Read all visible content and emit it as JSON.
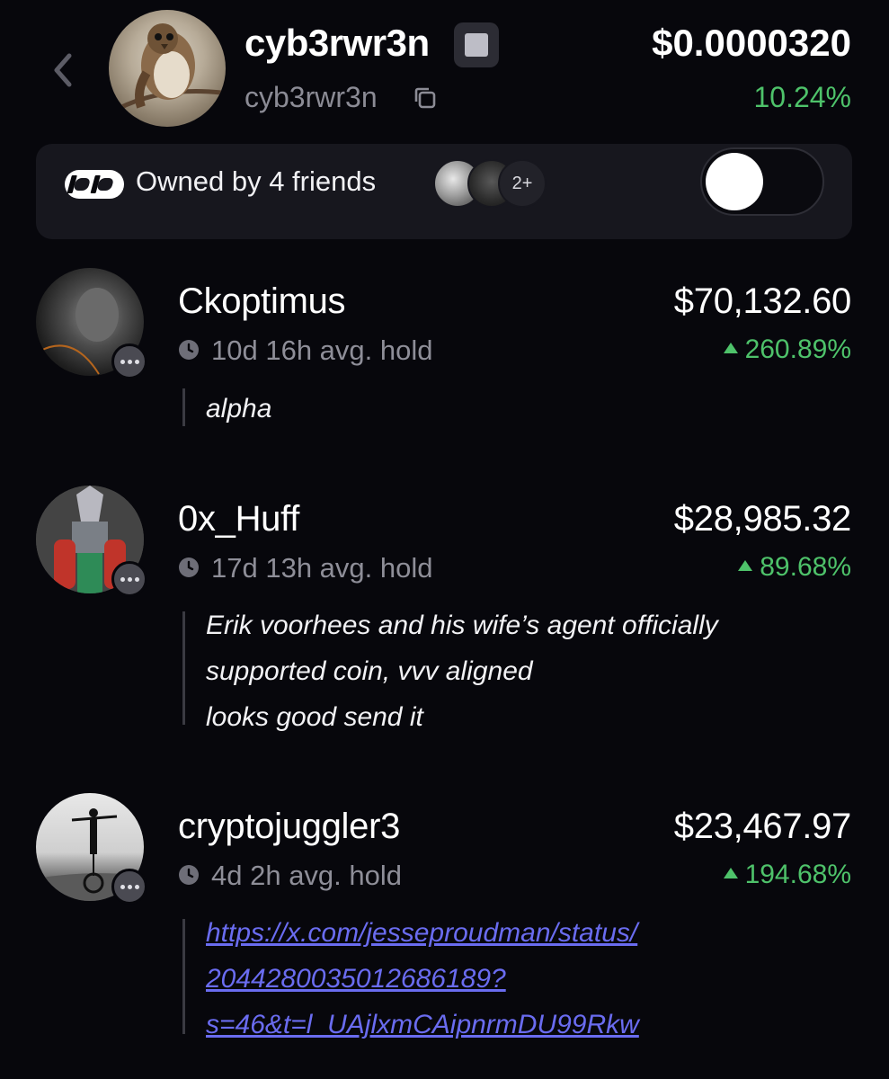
{
  "token": {
    "name": "cyb3rwr3n",
    "handle": "cyb3rwr3n",
    "price": "$0.0000320",
    "change": "10.24%"
  },
  "friends": {
    "label": "Owned by 4 friends",
    "more": "2+",
    "toggle_on": false
  },
  "colors": {
    "background": "#07070c",
    "card": "#17171e",
    "positive": "#4ec26a",
    "link": "#6a6cf0",
    "muted": "#8e8e98"
  },
  "holders": [
    {
      "name": "Ckoptimus",
      "value": "$70,132.60",
      "hold": "10d 16h avg. hold",
      "change": "260.89%",
      "comment": [
        "alpha"
      ]
    },
    {
      "name": "0x_Huff",
      "value": "$28,985.32",
      "hold": "17d 13h avg. hold",
      "change": "89.68%",
      "comment": [
        "Erik voorhees and his wife’s agent officially",
        "supported coin, vvv aligned",
        "looks good send it"
      ]
    },
    {
      "name": "cryptojuggler3",
      "value": "$23,467.97",
      "hold": "4d 2h avg. hold",
      "change": "194.68%",
      "comment": [
        "https://x.com/jesseproudman/status/",
        "2044280035012686189?",
        "s=46&t=l_UAjlxmCAipnrmDU99Rkw"
      ]
    }
  ]
}
